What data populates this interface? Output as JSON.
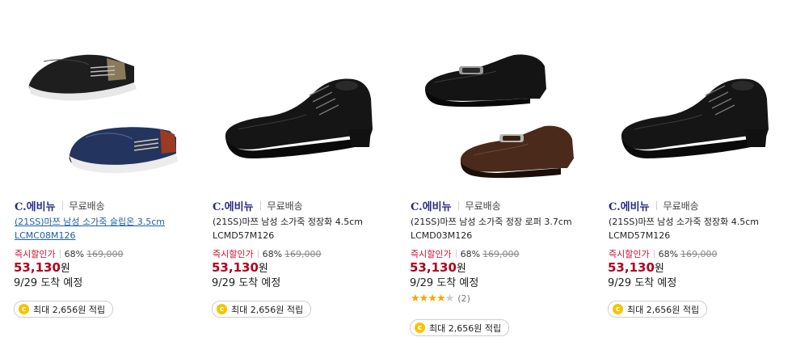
{
  "products": [
    {
      "brand_logo": "C.에비뉴",
      "shipping": "무료배송",
      "title": "(21SS)마쯔 남성 소가죽 슬립온 3.5cm LCMC08M126",
      "price_label": "즉시할인가",
      "discount": "68%",
      "original_price": "169,000",
      "price": "53,130",
      "currency": "원",
      "arrival": "9/29 도착 예정",
      "points": "최대 2,656원 적립",
      "image": "slip-on-black-navy"
    },
    {
      "brand_logo": "C.에비뉴",
      "shipping": "무료배송",
      "title": "(21SS)마쯔 남성 소가죽 정장화 4.5cm LCMD57M126",
      "price_label": "즉시할인가",
      "discount": "68%",
      "original_price": "169,000",
      "price": "53,130",
      "currency": "원",
      "arrival": "9/29 도착 예정",
      "points": "최대 2,656원 적립",
      "image": "oxford-black"
    },
    {
      "brand_logo": "C.에비뉴",
      "shipping": "무료배송",
      "title": "(21SS)마쯔 남성 소가죽 정장 로퍼 3.7cm LCMD03M126",
      "price_label": "즉시할인가",
      "discount": "68%",
      "original_price": "169,000",
      "price": "53,130",
      "currency": "원",
      "arrival": "9/29 도착 예정",
      "rating": 3.5,
      "review_count": "(2)",
      "points": "최대 2,656원 적립",
      "image": "loafer-black-brown"
    },
    {
      "brand_logo": "C.에비뉴",
      "shipping": "무료배송",
      "title": "(21SS)마쯔 남성 소가죽 정장화 4.5cm LCMD57M126",
      "price_label": "즉시할인가",
      "discount": "68%",
      "original_price": "169,000",
      "price": "53,130",
      "currency": "원",
      "arrival": "9/29 도착 예정",
      "points": "최대 2,656원 적립",
      "image": "oxford-black"
    }
  ],
  "colors": {
    "sale_red": "#c8102e",
    "price_red": "#b0001e",
    "link_blue": "#1a5fa8",
    "brand_navy": "#2c2c86",
    "star": "#f2a900",
    "coin": "#f5c400"
  },
  "icons": {
    "point_coin": "c-coin-icon",
    "star": "star-icon"
  }
}
